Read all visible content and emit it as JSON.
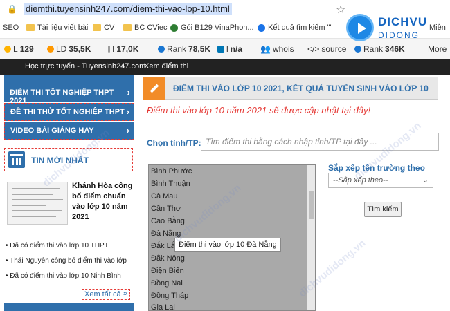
{
  "browser": {
    "url": "diemthi.tuyensinh247.com/diem-thi-vao-lop-10.html",
    "bookmarks": [
      "SEO",
      "Tài liệu viết bài",
      "CV",
      "BC CViec",
      "Gói B129 VinaPhon...",
      "Kết quả tìm kiếm \"\"",
      "Miễn"
    ],
    "seo": {
      "l": "L",
      "l_val": "129",
      "ld": "LD",
      "ld_val": "35,5K",
      "i": "I",
      "i_val": "17,0K",
      "rank": "Rank",
      "rank_val": "78,5K",
      "ln": "l",
      "ln_val": "n/a",
      "whois": "whois",
      "source": "source",
      "rank2": "Rank",
      "rank2_val": "346K",
      "more": "More"
    }
  },
  "logo": {
    "line1": "DICHVU",
    "line2": "DIDONG"
  },
  "topnav": {
    "item1": "Học trực tuyến - Tuyensinh247.com",
    "item2": "Xem điểm thi"
  },
  "sidebar": {
    "menu": [
      "ĐIỂM THI TỐT NGHIỆP THPT 2021",
      "ĐỀ THI THỬ TỐT NGHIỆP THPT",
      "VIDEO BÀI GIẢNG HAY"
    ],
    "menu_chevron": "›",
    "news_heading": "TIN MỚI NHẤT",
    "featured_title": "Khánh Hòa công bố điểm chuẩn vào lớp 10 năm 2021",
    "links": [
      "Đã có điểm thi vào lớp 10 THPT",
      "Thái Nguyên công bố điểm thi vào lớp",
      "Đã có điểm thi vào lớp 10 Ninh Bình"
    ],
    "see_all": "Xem tất cả"
  },
  "main": {
    "title": "ĐIỂM THI VÀO LỚP 10 2021, KẾT QUẢ TUYỂN SINH VÀO LỚP 10",
    "notice": "Điểm thi vào lớp 10 năm 2021 sẽ được cập nhật tại đây!",
    "province_label": "Chọn tỉnh/TP:",
    "province_placeholder": "Tìm điểm thi bằng cách nhập tỉnh/TP tại đây ...",
    "provinces": [
      "Bình Phước",
      "Bình Thuận",
      "Cà Mau",
      "Cần Thơ",
      "Cao Bằng",
      "Đà Nẵng",
      "Đắk Lắk",
      "Đắk Nông",
      "Điện Biên",
      "Đồng Nai",
      "Đồng Tháp",
      "Gia Lai"
    ],
    "tooltip": "Điểm thi vào lớp 10 Đà Nẵng",
    "sort_label": "Sắp xếp tên trường theo",
    "sort_value": "--Sắp xếp theo--",
    "search_button": "Tìm kiếm"
  },
  "watermark": "dichvudidong.vn"
}
